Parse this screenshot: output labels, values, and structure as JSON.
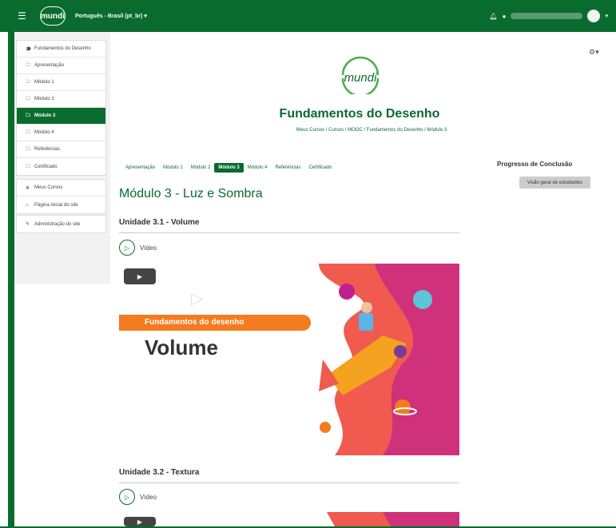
{
  "topbar": {
    "menu_icon": "hamburger-icon",
    "logo_text": "mundi",
    "language": "Português - Brasil (pt_br)",
    "language_caret": "▾",
    "user_caret": "▾",
    "bell_icon": "bell-icon",
    "chat_icon": "chat-icon"
  },
  "sidebar": {
    "course_items": [
      {
        "label": "Fundamentos do Desenho",
        "icon": "graduation-cap-icon",
        "glyph": "🎓"
      },
      {
        "label": "Apresentação",
        "icon": "folder-icon",
        "glyph": "🗀"
      },
      {
        "label": "Módulo 1",
        "icon": "folder-icon",
        "glyph": "🗀"
      },
      {
        "label": "Módulo 2",
        "icon": "folder-icon",
        "glyph": "🗀"
      },
      {
        "label": "Módulo 3",
        "icon": "folder-icon",
        "glyph": "🗀"
      },
      {
        "label": "Módulo 4",
        "icon": "folder-icon",
        "glyph": "🗀"
      },
      {
        "label": "Referências",
        "icon": "folder-icon",
        "glyph": "🗀"
      },
      {
        "label": "Certificado",
        "icon": "folder-icon",
        "glyph": "🗀"
      }
    ],
    "nav_items": [
      {
        "label": "Meus Cursos",
        "icon": "courses-icon",
        "glyph": "✲"
      },
      {
        "label": "Página inicial do site",
        "icon": "home-icon",
        "glyph": "⌂"
      }
    ],
    "admin_items": [
      {
        "label": "Administração do site",
        "icon": "wrench-icon",
        "glyph": "✎"
      }
    ]
  },
  "header": {
    "gear_icon": "gear-icon",
    "logo_text": "mundi",
    "course_title": "Fundamentos do Desenho",
    "breadcrumb": "Meus Cursos  /  Cursos  /  MOOC  /  Fundamentos do Desenho  /  Módulo 3"
  },
  "tabs": [
    "Apresentação",
    "Módulo 1",
    "Módulo 2",
    "Módulo 3",
    "Módulo 4",
    "Referências",
    "Certificado"
  ],
  "active_tab": "Módulo 3",
  "module_title": "Módulo 3 - Luz e Sombra",
  "units": [
    {
      "title": "Unidade 3.1 - Volume",
      "activity": "Vídeo",
      "banner_tag": "Fundamentos do desenho",
      "banner_title": "Volume"
    },
    {
      "title": "Unidade 3.2 - Textura",
      "activity": "Vídeo"
    }
  ],
  "progress": {
    "title": "Progresso de Conclusão",
    "button": "Visão geral de estudantes"
  },
  "colors": {
    "brand": "#0a6b2f",
    "accent_orange": "#f47b20",
    "accent_magenta": "#c0208f"
  }
}
